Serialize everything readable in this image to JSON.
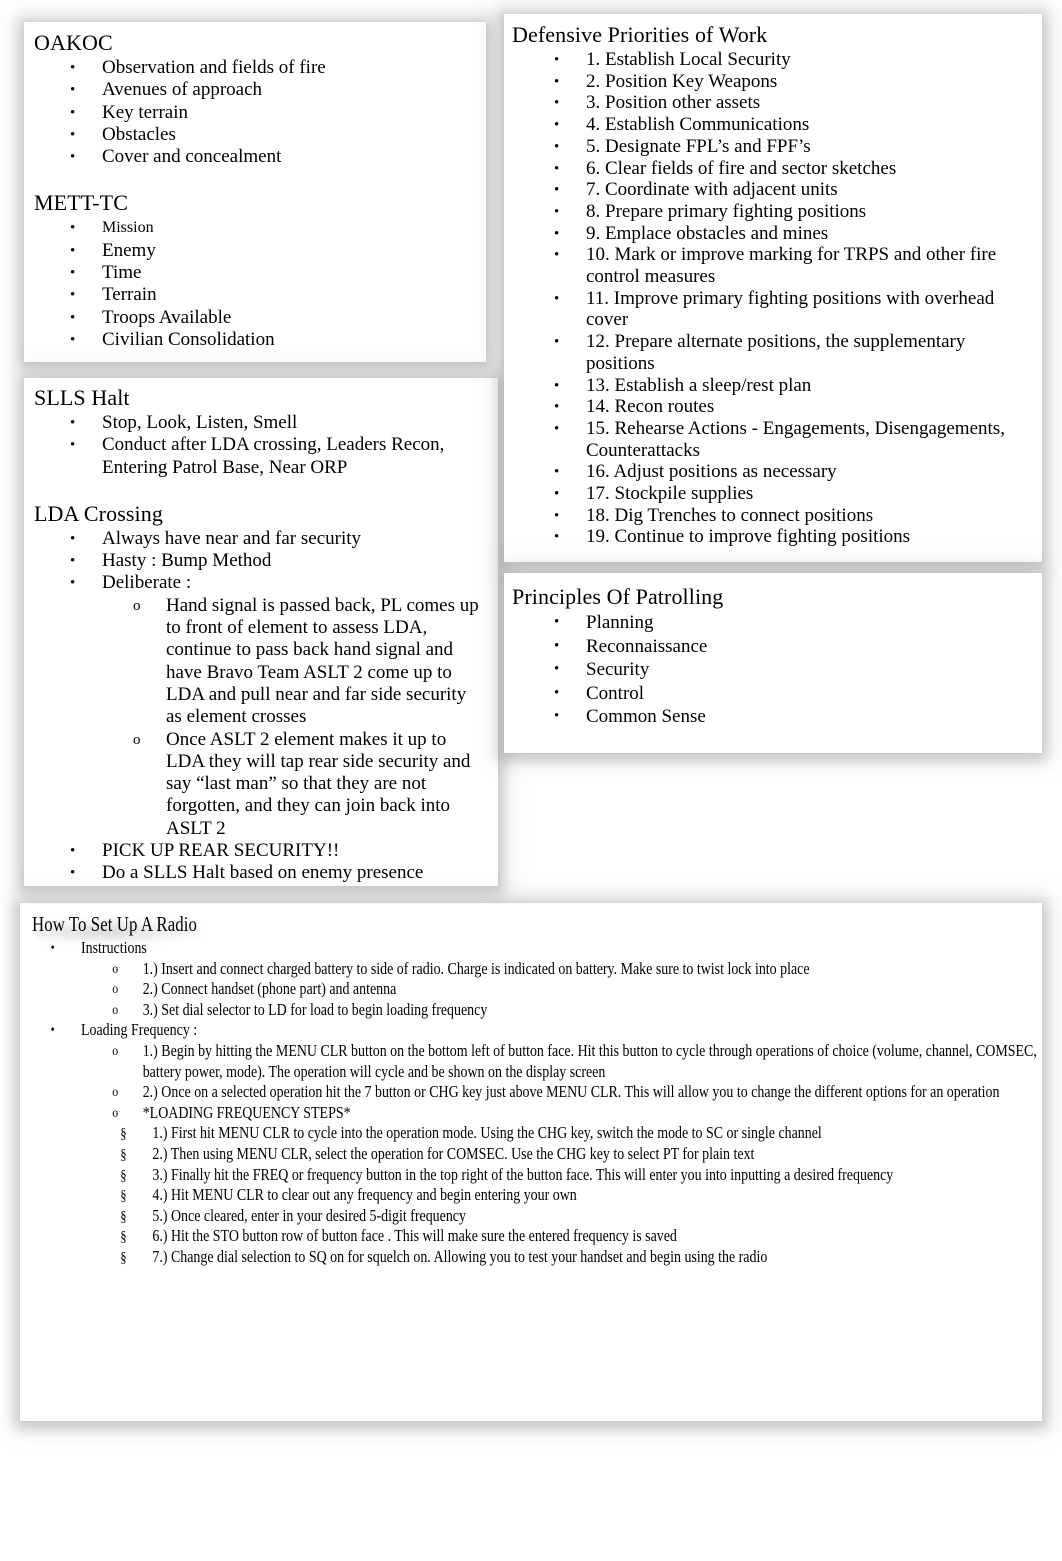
{
  "document": {
    "background_color": "#ffffff",
    "panel_color": "#ffffff",
    "text_color": "#000000"
  },
  "panels": {
    "oakoc": {
      "title": "OAKOC",
      "items": [
        "Observation and fields of fire",
        "Avenues of approach",
        "Key terrain",
        "Obstacles",
        "Cover and concealment"
      ]
    },
    "mett_tc": {
      "title": "METT-TC",
      "items": [
        "Mission",
        "Enemy",
        "Time",
        "Terrain",
        "Troops Available",
        "Civilian Consolidation"
      ]
    },
    "slls_halt": {
      "title": "SLLS Halt",
      "items": [
        "Stop, Look, Listen, Smell",
        "Conduct after LDA crossing, Leaders Recon, Entering Patrol Base, Near ORP"
      ]
    },
    "lda_crossing": {
      "title": "LDA Crossing",
      "items": [
        "Always have near and far security",
        "Hasty : Bump Method",
        "Deliberate :"
      ],
      "deliberate_sub": [
        "Hand signal is passed back, PL comes up to front of element to assess LDA, continue to pass back hand signal and have Bravo Team ASLT 2 come up to LDA and pull near and far side security as element crosses",
        "Once ASLT 2 element makes it up to LDA they will tap rear side security and say “last man” so that they are not forgotten, and they can join back into ASLT 2"
      ],
      "trailing_items": [
        "PICK UP REAR SECURITY!!",
        "Do a SLLS Halt based on enemy presence"
      ]
    },
    "defensive_priorities": {
      "title": "Defensive Priorities of Work",
      "items": [
        "1. Establish Local Security",
        "2. Position Key Weapons",
        "3. Position other assets",
        "4. Establish Communications",
        "5. Designate FPL’s and FPF’s",
        "6. Clear fields of fire and sector sketches",
        "7. Coordinate with adjacent units",
        "8. Prepare primary fighting positions",
        "9. Emplace obstacles and mines",
        "10. Mark or improve marking for TRPS and other fire control measures",
        "11. Improve primary fighting positions with overhead cover",
        "12. Prepare alternate positions, the supplementary positions",
        "13. Establish a sleep/rest plan",
        "14. Recon routes",
        "15. Rehearse Actions - Engagements, Disengagements, Counterattacks",
        "16. Adjust positions as necessary",
        "17. Stockpile supplies",
        "18. Dig Trenches to connect positions",
        "19. Continue to improve fighting positions"
      ]
    },
    "principles_of_patrolling": {
      "title": "Principles Of Patrolling",
      "items": [
        "Planning",
        "Reconnaissance",
        "Security",
        "Control",
        "Common Sense"
      ]
    },
    "radio": {
      "title": "How To Set Up A Radio",
      "instructions_label": "Instructions",
      "instructions": [
        "1.) Insert and connect charged battery to side of radio. Charge is indicated on battery. Make sure to twist lock into place",
        "2.) Connect handset (phone part) and antenna",
        "3.) Set dial selector to LD for load to begin loading frequency"
      ],
      "loading_frequency_label": "Loading Frequency  :",
      "loading_frequency": [
        "1.) Begin by hitting the MENU CLR button on the bottom left of button face. Hit this button to cycle through operations of choice (volume, channel, COMSEC, battery power, mode). The operation will cycle and be shown on the display screen",
        "2.) Once on a selected operation hit the 7 button or CHG key just above MENU CLR. This will allow you to change the different options for an operation"
      ],
      "loading_steps_header": "*LOADING FREQUENCY STEPS*",
      "loading_steps": [
        "1.) First hit MENU CLR to cycle into the operation mode. Using the CHG key, switch the mode to SC or single channel",
        "2.) Then using MENU CLR, select the operation for COMSEC. Use the CHG key to select PT for plain text",
        "3.) Finally hit the FREQ or frequency button in the top right of the button face. This will enter you into inputting a desired frequency",
        "4.) Hit MENU CLR to clear out any frequency and begin entering your own",
        "5.) Once cleared, enter in your desired 5-digit frequency",
        "6.) Hit the STO button row of button face    . This will make sure the entered frequency is saved",
        "7.) Change dial selection to SQ on for squelch on. Allowing you to test your handset and begin using the radio"
      ]
    }
  },
  "markers": {
    "bullet": "•",
    "circle": "o",
    "section": "§"
  }
}
